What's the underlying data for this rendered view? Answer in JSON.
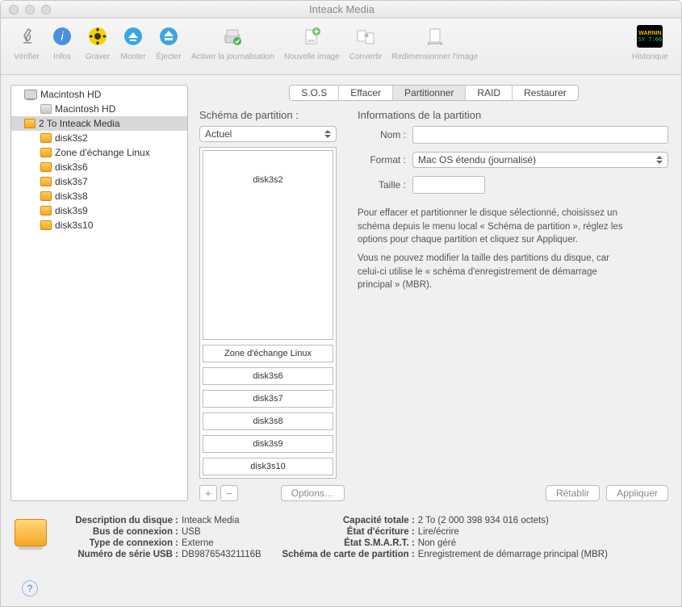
{
  "window_title": "Inteack Media",
  "toolbar": [
    {
      "label": "Vérifier"
    },
    {
      "label": "Infos"
    },
    {
      "label": "Graver"
    },
    {
      "label": "Monter"
    },
    {
      "label": "Éjecter"
    },
    {
      "label": "Activer la journalisation"
    },
    {
      "label": "Nouvelle image"
    },
    {
      "label": "Convertir"
    },
    {
      "label": "Redimensionner l'image"
    }
  ],
  "toolbar_right": {
    "label": "Historique"
  },
  "sidebar": [
    {
      "label": "Macintosh HD",
      "icon": "hd",
      "level": 0
    },
    {
      "label": "Macintosh HD",
      "icon": "vol-grey",
      "level": 1
    },
    {
      "label": "2 To Inteack Media",
      "icon": "vol-orange",
      "level": 0,
      "selected": true
    },
    {
      "label": "disk3s2",
      "icon": "vol-orange",
      "level": 1
    },
    {
      "label": "Zone d'échange Linux",
      "icon": "vol-orange",
      "level": 1
    },
    {
      "label": "disk3s6",
      "icon": "vol-orange",
      "level": 1
    },
    {
      "label": "disk3s7",
      "icon": "vol-orange",
      "level": 1
    },
    {
      "label": "disk3s8",
      "icon": "vol-orange",
      "level": 1
    },
    {
      "label": "disk3s9",
      "icon": "vol-orange",
      "level": 1
    },
    {
      "label": "disk3s10",
      "icon": "vol-orange",
      "level": 1
    }
  ],
  "tabs": [
    "S.O.S",
    "Effacer",
    "Partitionner",
    "RAID",
    "Restaurer"
  ],
  "active_tab": "Partitionner",
  "scheme_heading": "Schéma de partition :",
  "scheme_dropdown": "Actuel",
  "partitions": [
    "disk3s2",
    "Zone d'échange Linux",
    "disk3s6",
    "disk3s7",
    "disk3s8",
    "disk3s9",
    "disk3s10"
  ],
  "options_btn": "Options…",
  "info_heading": "Informations de la partition",
  "labels": {
    "nom": "Nom :",
    "format": "Format :",
    "taille": "Taille :"
  },
  "format_value": "Mac OS étendu (journalisé)",
  "nom_value": "",
  "taille_value": "",
  "info_para1": "Pour effacer et partitionner le disque sélectionné, choisissez un schéma depuis le menu local « Schéma de partition », réglez les options pour chaque partition et cliquez sur Appliquer.",
  "info_para2": "Vous ne pouvez modifier la taille des partitions du disque, car celui-ci utilise le « schéma d'enregistrement de démarrage principal » (MBR).",
  "revert_btn": "Rétablir",
  "apply_btn": "Appliquer",
  "footer_left": [
    {
      "k": "Description du disque :",
      "v": "Inteack Media"
    },
    {
      "k": "Bus de connexion :",
      "v": "USB"
    },
    {
      "k": "Type de connexion :",
      "v": "Externe"
    },
    {
      "k": "Numéro de série USB :",
      "v": "DB987654321116B"
    }
  ],
  "footer_right": [
    {
      "k": "Capacité totale :",
      "v": "2 To (2 000 398 934 016 octets)"
    },
    {
      "k": "État d'écriture :",
      "v": "Lire/écrire"
    },
    {
      "k": "État S.M.A.R.T. :",
      "v": "Non géré"
    },
    {
      "k": "Schéma de carte de partition :",
      "v": "Enregistrement de démarrage principal (MBR)"
    }
  ]
}
